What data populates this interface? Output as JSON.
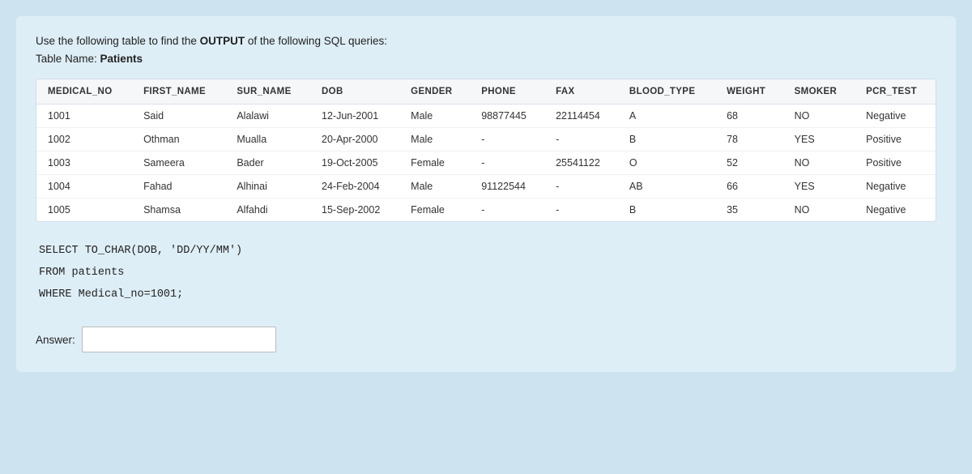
{
  "instructions": {
    "line1": "Use the following table to find the ",
    "bold": "OUTPUT",
    "line2": " of the following SQL queries:",
    "line3": "Table Name: ",
    "table_name": "Patients"
  },
  "table": {
    "columns": [
      "MEDICAL_NO",
      "FIRST_NAME",
      "SUR_NAME",
      "DOB",
      "GENDER",
      "PHONE",
      "FAX",
      "BLOOD_TYPE",
      "WEIGHT",
      "SMOKER",
      "PCR_TEST"
    ],
    "rows": [
      {
        "medical_no": "1001",
        "first_name": "Said",
        "sur_name": "Alalawi",
        "dob": "12-Jun-2001",
        "gender": "Male",
        "phone": "98877445",
        "fax": "22114454",
        "blood_type": "A",
        "weight": "68",
        "smoker": "NO",
        "pcr_test": "Negative"
      },
      {
        "medical_no": "1002",
        "first_name": "Othman",
        "sur_name": "Mualla",
        "dob": "20-Apr-2000",
        "gender": "Male",
        "phone": "-",
        "fax": "-",
        "blood_type": "B",
        "weight": "78",
        "smoker": "YES",
        "pcr_test": "Positive"
      },
      {
        "medical_no": "1003",
        "first_name": "Sameera",
        "sur_name": "Bader",
        "dob": "19-Oct-2005",
        "gender": "Female",
        "phone": "-",
        "fax": "25541122",
        "blood_type": "O",
        "weight": "52",
        "smoker": "NO",
        "pcr_test": "Positive"
      },
      {
        "medical_no": "1004",
        "first_name": "Fahad",
        "sur_name": "Alhinai",
        "dob": "24-Feb-2004",
        "gender": "Male",
        "phone": "91122544",
        "fax": "-",
        "blood_type": "AB",
        "weight": "66",
        "smoker": "YES",
        "pcr_test": "Negative"
      },
      {
        "medical_no": "1005",
        "first_name": "Shamsa",
        "sur_name": "Alfahdi",
        "dob": "15-Sep-2002",
        "gender": "Female",
        "phone": "-",
        "fax": "-",
        "blood_type": "B",
        "weight": "35",
        "smoker": "NO",
        "pcr_test": "Negative"
      }
    ]
  },
  "sql": {
    "line1": "SELECT TO_CHAR(DOB, 'DD/YY/MM')",
    "line2": "FROM patients",
    "line3": "WHERE Medical_no=1001;"
  },
  "answer": {
    "label": "Answer:",
    "placeholder": ""
  }
}
